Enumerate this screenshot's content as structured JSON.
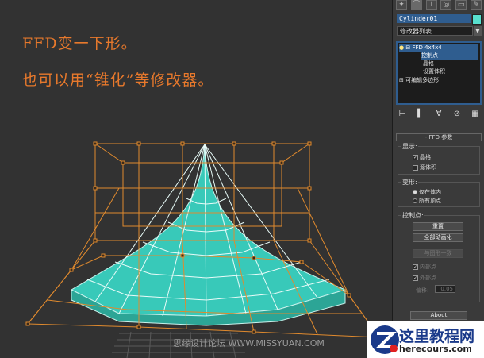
{
  "viewport": {
    "caption_line1": "FFD变一下形。",
    "caption_line2": "也可以用“锥化”等修改器。",
    "watermark": "思缘设计论坛 WWW.MISSYUAN.COM"
  },
  "command_panel": {
    "tab_icons": [
      "create-icon",
      "modify-icon",
      "hierarchy-icon",
      "motion-icon",
      "display-icon",
      "utilities-icon"
    ],
    "object_name": "Cylinder01",
    "object_color": "#58e0cf",
    "modifier_list_label": "修改器列表",
    "stack": {
      "items": [
        {
          "label": "FFD 4x4x4",
          "selected": true
        },
        {
          "label": "控制点",
          "selected": true
        },
        {
          "label": "晶格",
          "selected": false
        },
        {
          "label": "设置体积",
          "selected": false
        },
        {
          "label": "可编辑多边形",
          "selected": false
        }
      ]
    },
    "rollout_title": "FFD 参数",
    "display_group": {
      "title": "显示:",
      "lattice": "晶格",
      "lattice_checked": true,
      "source_volume": "源体积",
      "source_volume_checked": false
    },
    "deform_group": {
      "title": "变形:",
      "inside_volume": "仅在体内",
      "all_vertices": "所有顶点",
      "selected_option": "inside_volume"
    },
    "control_points_group": {
      "title": "控制点:",
      "reset_label": "重置",
      "animate_all_label": "全部动画化",
      "conform_label": "与图形一致",
      "inside_points": "内部点",
      "outside_points": "外部点",
      "offset_label": "偏移:",
      "offset_value": "0.05"
    },
    "about_label": "About"
  },
  "logo": {
    "title": "这里教程网",
    "url": "herecours.com",
    "brand_color": "#1a3a8a"
  }
}
